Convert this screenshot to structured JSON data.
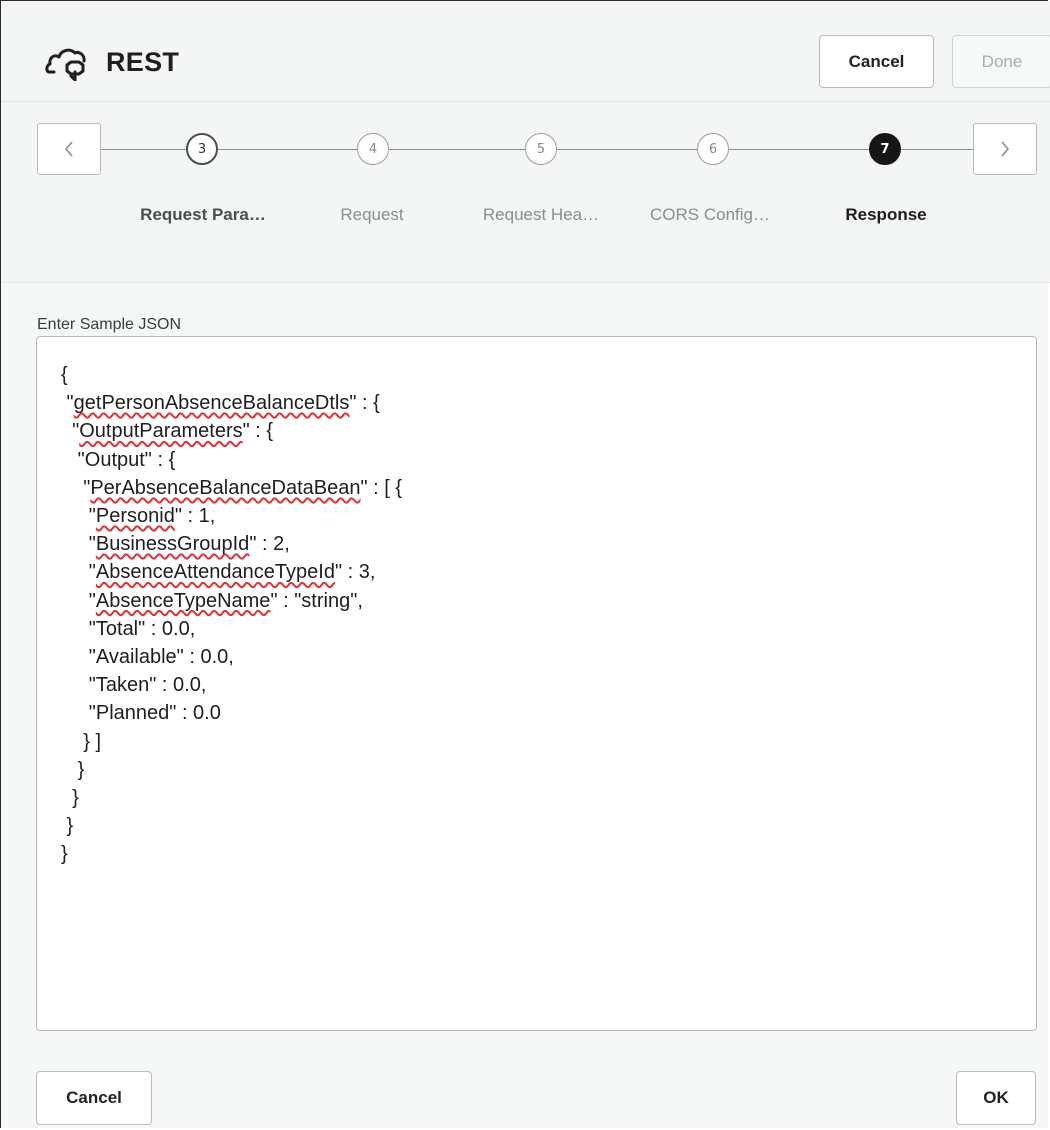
{
  "header": {
    "title": "REST",
    "title_icon": "cloud-connector-icon",
    "cancel_label": "Cancel",
    "done_label": "Done"
  },
  "train": {
    "prev_icon": "chevron-left-icon",
    "next_icon": "chevron-right-icon",
    "steps": [
      {
        "number": "3",
        "label": "Request Para…",
        "state": "visited"
      },
      {
        "number": "4",
        "label": "Request",
        "state": "unvisited"
      },
      {
        "number": "5",
        "label": "Request Hea…",
        "state": "unvisited"
      },
      {
        "number": "6",
        "label": "CORS Config…",
        "state": "unvisited"
      },
      {
        "number": "7",
        "label": "Response",
        "state": "current"
      }
    ]
  },
  "body": {
    "field_label": "Enter Sample JSON",
    "json_lines": [
      "{",
      " \"getPersonAbsenceBalanceDtls\" : {",
      "  \"OutputParameters\" : {",
      "   \"Output\" : {",
      "    \"PerAbsenceBalanceDataBean\" : [ {",
      "     \"Personid\" : 1,",
      "     \"BusinessGroupId\" : 2,",
      "     \"AbsenceAttendanceTypeId\" : 3,",
      "     \"AbsenceTypeName\" : \"string\",",
      "     \"Total\" : 0.0,",
      "     \"Available\" : 0.0,",
      "     \"Taken\" : 0.0,",
      "     \"Planned\" : 0.0",
      "    } ]",
      "   }",
      "  }",
      " }",
      "}"
    ],
    "misspelled_words": [
      "getPersonAbsenceBalanceDtls",
      "OutputParameters",
      "PerAbsenceBalanceDataBean",
      "Personid",
      "BusinessGroupId",
      "AbsenceAttendanceTypeId",
      "AbsenceTypeName"
    ]
  },
  "footer": {
    "cancel_label": "Cancel",
    "ok_label": "OK"
  },
  "colors": {
    "background": "#f6f7f7",
    "current_step": "#161616",
    "spellcheck": "#dd3333"
  }
}
